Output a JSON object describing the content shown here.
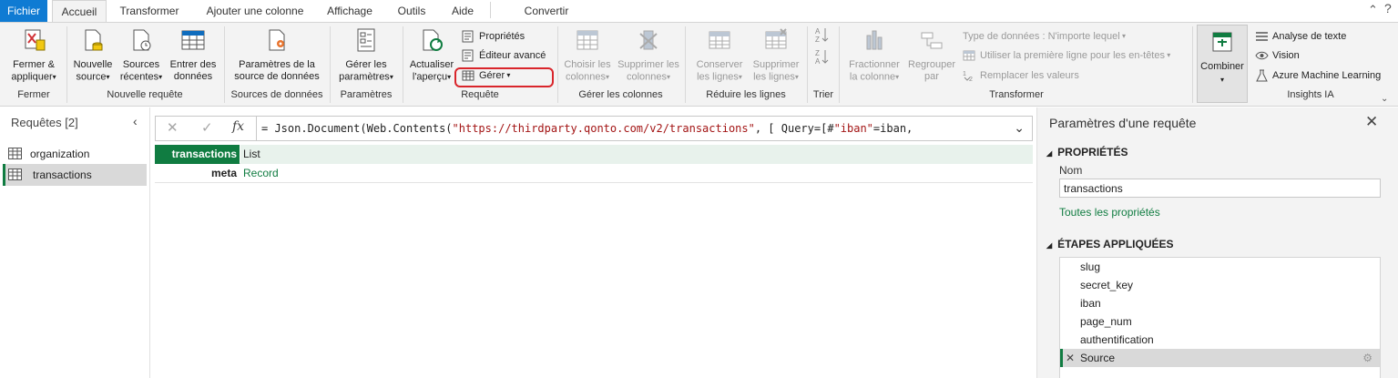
{
  "tabs": [
    "Fichier",
    "Accueil",
    "Transformer",
    "Ajouter une colonne",
    "Affichage",
    "Outils",
    "Aide",
    "Convertir"
  ],
  "ribbon": {
    "close_apply": "Fermer &\nappliquer",
    "new_source": "Nouvelle\nsource",
    "recent_sources": "Sources\nrécentes",
    "enter_data": "Entrer des\ndonnées",
    "datasource_settings": "Paramètres de la\nsource de données",
    "manage_params": "Gérer les\nparamètres",
    "refresh": "Actualiser\nl'aperçu",
    "properties": "Propriétés",
    "advanced_editor": "Éditeur avancé",
    "manage": "Gérer",
    "choose_cols": "Choisir les\ncolonnes",
    "remove_cols": "Supprimer les\ncolonnes",
    "keep_rows": "Conserver\nles lignes",
    "remove_rows": "Supprimer\nles lignes",
    "split_col": "Fractionner\nla colonne",
    "group_by": "Regrouper\npar",
    "data_type": "Type de données : N'importe lequel",
    "first_row_headers": "Utiliser la première ligne pour les en-têtes",
    "replace_values": "Remplacer les valeurs",
    "combine": "Combiner",
    "text_analytics": "Analyse de texte",
    "vision": "Vision",
    "azure_ml": "Azure Machine Learning",
    "groups": {
      "close": "Fermer",
      "new_query": "Nouvelle requête",
      "data_sources": "Sources de données",
      "parameters": "Paramètres",
      "query": "Requête",
      "manage_cols": "Gérer les colonnes",
      "reduce_rows": "Réduire les lignes",
      "sort": "Trier",
      "transform": "Transformer",
      "ai_insights": "Insights IA"
    }
  },
  "queries": {
    "header": "Requêtes [2]",
    "items": [
      "organization",
      "transactions"
    ],
    "selected": "transactions"
  },
  "formula": {
    "prefix": "= Json.Document(Web.Contents(",
    "url": "\"https://thirdparty.qonto.com/v2/transactions\"",
    "mid": ", [ Query=[#",
    "key": "\"iban\"",
    "suffix": "=iban,"
  },
  "grid": {
    "rows": [
      {
        "key": "transactions",
        "value": "List"
      },
      {
        "key": "meta",
        "value": "Record"
      }
    ]
  },
  "settings": {
    "title": "Paramètres d'une requête",
    "properties_header": "PROPRIÉTÉS",
    "name_label": "Nom",
    "name_value": "transactions",
    "all_properties": "Toutes les propriétés",
    "steps_header": "ÉTAPES APPLIQUÉES",
    "steps": [
      "slug",
      "secret_key",
      "iban",
      "page_num",
      "authentification",
      "Source"
    ],
    "selected_step": "Source"
  }
}
